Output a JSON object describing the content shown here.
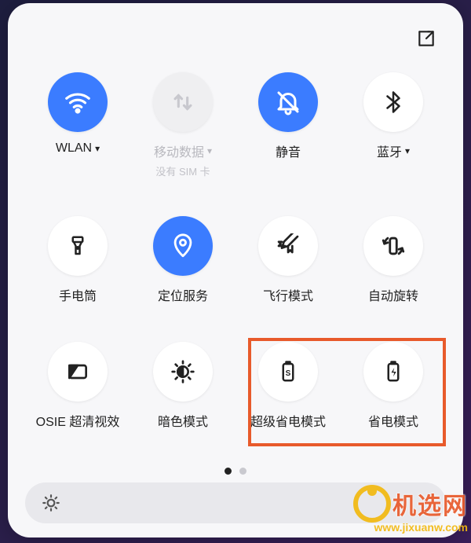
{
  "colors": {
    "accent": "#3b7cff",
    "highlight": "#e85a2b"
  },
  "tiles": [
    {
      "id": "wlan",
      "label": "WLAN",
      "sub": "",
      "has_chev": true,
      "state": "on"
    },
    {
      "id": "data",
      "label": "移动数据",
      "sub": "没有 SIM 卡",
      "has_chev": true,
      "state": "disabled"
    },
    {
      "id": "mute",
      "label": "静音",
      "sub": "",
      "has_chev": false,
      "state": "on"
    },
    {
      "id": "bt",
      "label": "蓝牙",
      "sub": "",
      "has_chev": true,
      "state": "off"
    },
    {
      "id": "torch",
      "label": "手电筒",
      "sub": "",
      "has_chev": false,
      "state": "off"
    },
    {
      "id": "location",
      "label": "定位服务",
      "sub": "",
      "has_chev": false,
      "state": "on"
    },
    {
      "id": "airplane",
      "label": "飞行模式",
      "sub": "",
      "has_chev": false,
      "state": "off"
    },
    {
      "id": "autorotate",
      "label": "自动旋转",
      "sub": "",
      "has_chev": false,
      "state": "off"
    },
    {
      "id": "osie",
      "label": "OSIE 超清视效",
      "sub": "",
      "has_chev": false,
      "state": "off"
    },
    {
      "id": "darkmode",
      "label": "暗色模式",
      "sub": "",
      "has_chev": false,
      "state": "off"
    },
    {
      "id": "ultrasave",
      "label": "超级省电模式",
      "sub": "",
      "has_chev": false,
      "state": "off"
    },
    {
      "id": "powersave",
      "label": "省电模式",
      "sub": "",
      "has_chev": false,
      "state": "off"
    }
  ],
  "pager": {
    "total": 2,
    "current": 0
  },
  "watermark": {
    "brand": "机选网",
    "url": "www.jixuanw.com"
  }
}
